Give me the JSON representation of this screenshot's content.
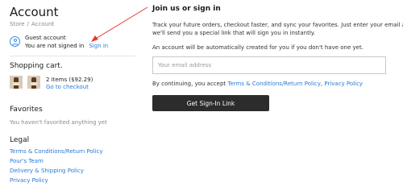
{
  "account": {
    "title": "Account",
    "breadcrumb": [
      "Store",
      "/",
      "Account"
    ],
    "guest": {
      "title": "Guest account",
      "status_text": "You are not signed in",
      "signin_link": "Sign in",
      "icon": "user-icon"
    }
  },
  "cart": {
    "title": "Shopping cart.",
    "summary": "2 items ($92.29)",
    "checkout_link": "Go to checkout",
    "thumbnails": [
      "wine-bottle-thumbnail",
      "wine-bottle-thumbnail"
    ]
  },
  "favorites": {
    "title": "Favorites",
    "empty_text": "You haven't favorited anything yet"
  },
  "legal": {
    "title": "Legal",
    "links": [
      "Terms & Conditions/Return Policy",
      "Pour's Team",
      "Delivery & Shipping Policy",
      "Privacy Policy"
    ]
  },
  "signin": {
    "title": "Join us or sign in",
    "description_lines": [
      "Track your future orders, checkout faster, and sync your favorites. Just enter your email and",
      "we'll send you a special link that will sign you in instantly."
    ],
    "auto_create_text": "An account will be automatically created for you if you don't have one yet.",
    "email_placeholder": "Your email address",
    "email_value": "",
    "consent_prefix": "By continuing, you accept ",
    "consent_terms_link": "Terms & Conditions/Return Policy",
    "consent_separator": ", ",
    "consent_privacy_link": "Privacy Policy",
    "submit_label": "Get Sign-In Link"
  },
  "annotation": {
    "arrow_color": "#e8372c"
  }
}
